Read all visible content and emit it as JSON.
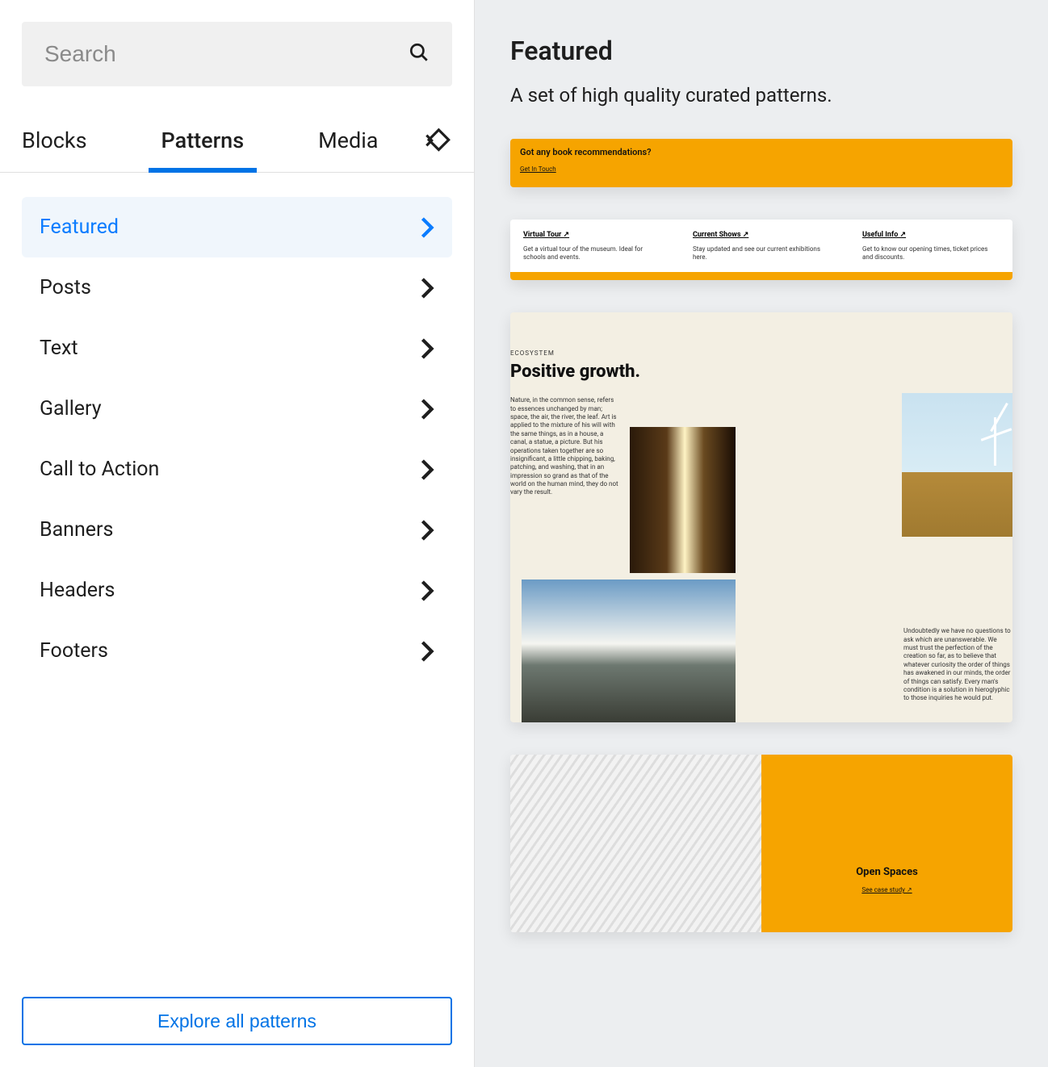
{
  "search": {
    "placeholder": "Search"
  },
  "tabs": [
    {
      "label": "Blocks",
      "active": false
    },
    {
      "label": "Patterns",
      "active": true
    },
    {
      "label": "Media",
      "active": false
    }
  ],
  "categories": [
    {
      "label": "Featured",
      "active": true
    },
    {
      "label": "Posts",
      "active": false
    },
    {
      "label": "Text",
      "active": false
    },
    {
      "label": "Gallery",
      "active": false
    },
    {
      "label": "Call to Action",
      "active": false
    },
    {
      "label": "Banners",
      "active": false
    },
    {
      "label": "Headers",
      "active": false
    },
    {
      "label": "Footers",
      "active": false
    }
  ],
  "explore_button": "Explore all patterns",
  "preview": {
    "title": "Featured",
    "subtitle": "A set of high quality curated patterns."
  },
  "pattern1": {
    "title": "Got any book recommendations?",
    "link": "Get In Touch"
  },
  "pattern2": {
    "cols": [
      {
        "head": "Virtual Tour ↗",
        "text": "Get a virtual tour of the museum. Ideal for schools and events."
      },
      {
        "head": "Current Shows ↗",
        "text": "Stay updated and see our current exhibitions here."
      },
      {
        "head": "Useful Info ↗",
        "text": "Get to know our opening times, ticket prices and discounts."
      }
    ]
  },
  "pattern3": {
    "eyebrow": "ECOSYSTEM",
    "title": "Positive growth.",
    "body": "Nature, in the common sense, refers to essences unchanged by man; space, the air, the river, the leaf. Art is applied to the mixture of his will with the same things, as in a house, a canal, a statue, a picture. But his operations taken together are so insignificant, a little chipping, baking, patching, and washing, that in an impression so grand as that of the world on the human mind, they do not vary the result.",
    "right": "Undoubtedly we have no questions to ask which are unanswerable. We must trust the perfection of the creation so far, as to believe that whatever curiosity the order of things has awakened in our minds, the order of things can satisfy. Every man's condition is a solution in hieroglyphic to those inquiries he would put."
  },
  "pattern4": {
    "title": "Open Spaces",
    "link": "See case study ↗"
  }
}
